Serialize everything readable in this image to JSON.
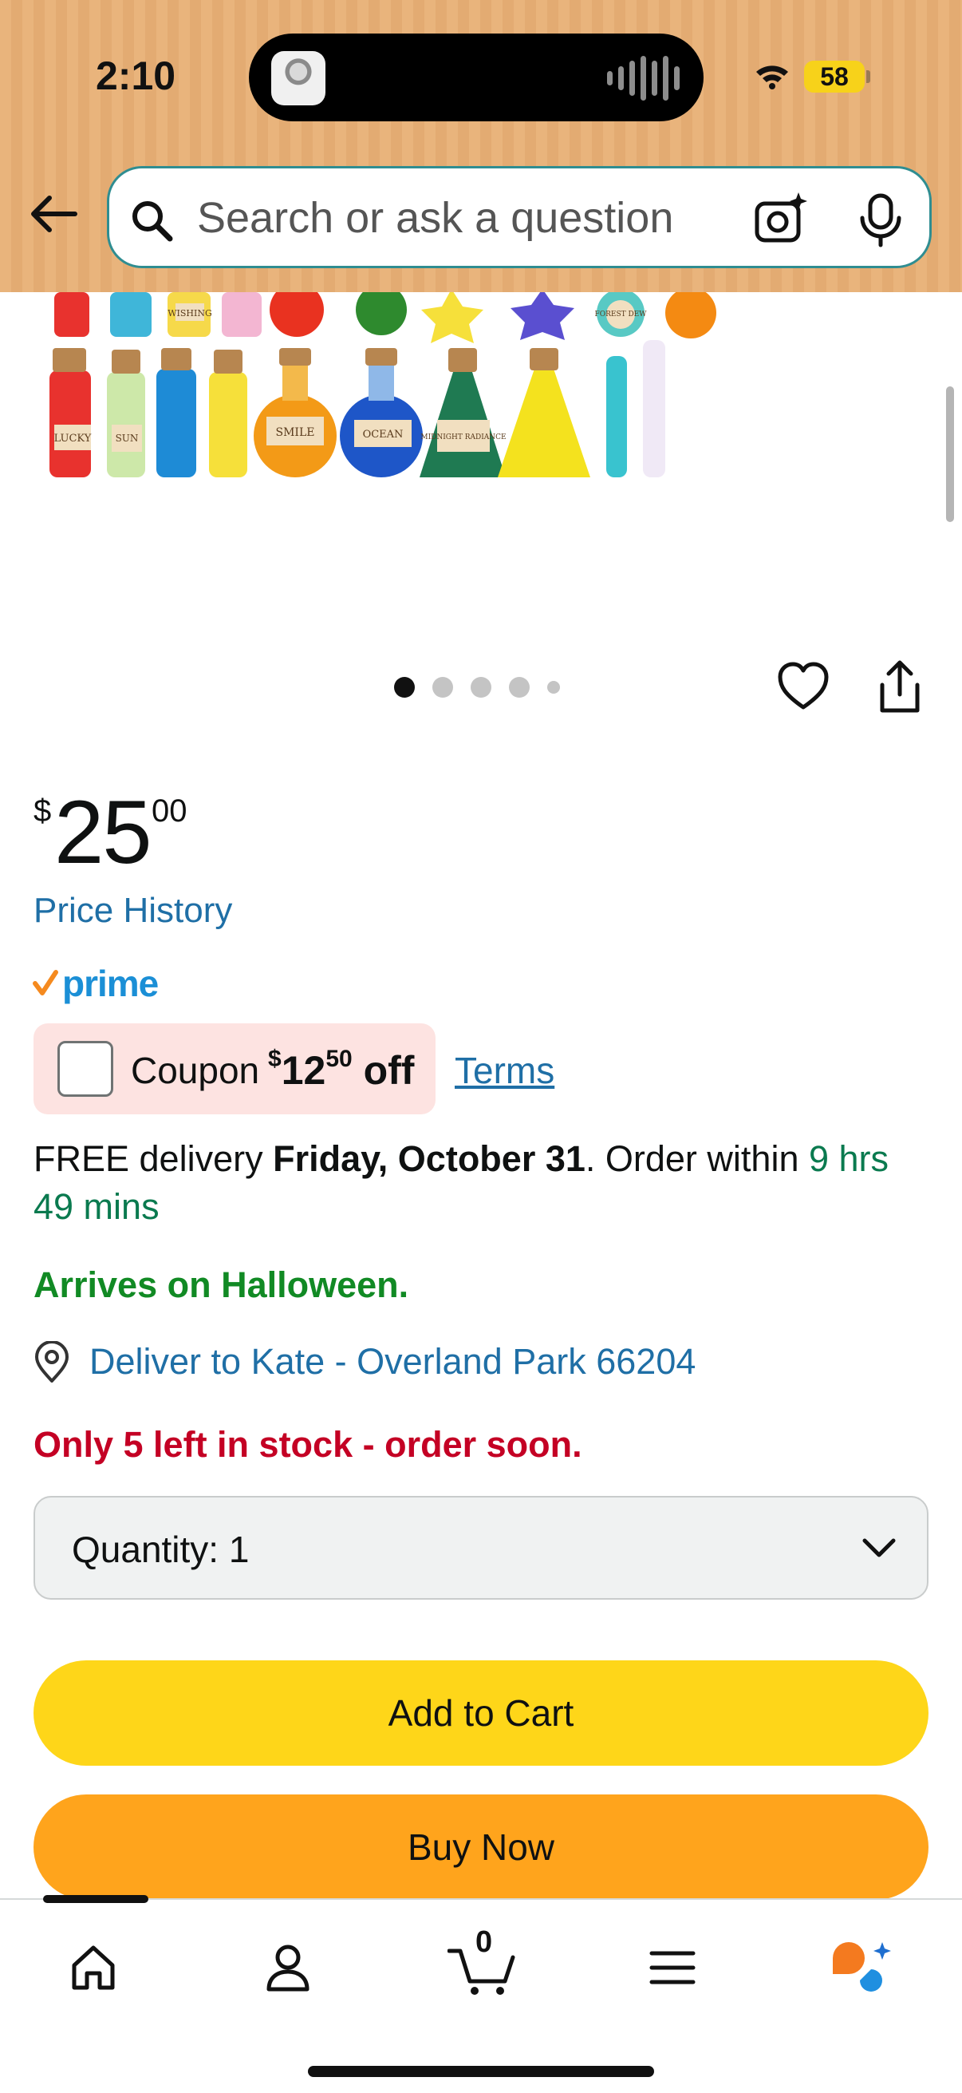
{
  "status_bar": {
    "time": "2:10",
    "battery": "58"
  },
  "search": {
    "placeholder": "Search or ask a question"
  },
  "product_image": {
    "labels": [
      "WISHING",
      "FOREST DEW",
      "LUCKY",
      "SUN",
      "SMILE",
      "OCEAN",
      "MIDNIGHT RADIANCE"
    ],
    "slide_count": 5,
    "active_slide": 1
  },
  "price": {
    "symbol": "$",
    "whole": "25",
    "fraction": "00"
  },
  "price_history_link": "Price History",
  "prime_label": "prime",
  "coupon": {
    "label": "Coupon",
    "symbol": "$",
    "amount": "12",
    "cents": "50",
    "suffix": "off"
  },
  "terms_link": "Terms",
  "delivery": {
    "prefix": "FREE delivery ",
    "date": "Friday, October 31",
    "middle": ". Order within ",
    "countdown": "9 hrs 49 mins"
  },
  "arrives_note": "Arrives on Halloween.",
  "deliver_to": "Deliver to Kate - Overland Park 66204",
  "stock_warning": "Only 5 left in stock - order soon.",
  "quantity": {
    "label": "Quantity:",
    "value": "1"
  },
  "buttons": {
    "add_to_cart": "Add to Cart",
    "buy_now": "Buy Now"
  },
  "bottom_nav": {
    "cart_count": "0"
  },
  "colors": {
    "header_bg": "#e9b47c",
    "link": "#1f6fa6",
    "add_to_cart": "#fed619",
    "buy_now": "#ffa41c",
    "stock_warning": "#c40024",
    "arrives": "#118a24",
    "countdown": "#0a7a4f",
    "prime": "#1b8fd6",
    "coupon_bg": "#fde3e1"
  },
  "icons": [
    "back-arrow-icon",
    "search-icon",
    "camera-search-icon",
    "microphone-icon",
    "heart-icon",
    "share-icon",
    "location-pin-icon",
    "chevron-down-icon",
    "home-icon",
    "account-icon",
    "cart-icon",
    "menu-icon",
    "rufus-assistant-icon"
  ]
}
